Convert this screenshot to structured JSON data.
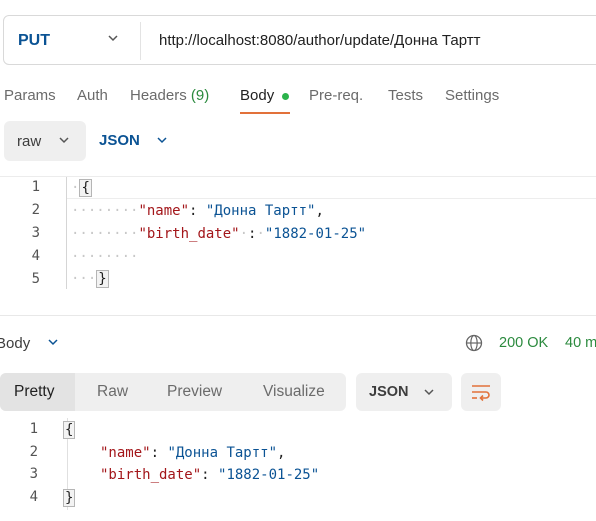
{
  "request": {
    "method": "PUT",
    "url": "http://localhost:8080/author/update/Донна Тартт"
  },
  "tabs": [
    {
      "label": "Params"
    },
    {
      "label": "Auth"
    },
    {
      "label": "Headers",
      "count": "(9)"
    },
    {
      "label": "Body"
    },
    {
      "label": "Pre-req."
    },
    {
      "label": "Tests"
    },
    {
      "label": "Settings"
    }
  ],
  "body_options": {
    "mode": "raw",
    "format": "JSON"
  },
  "request_editor": {
    "line_numbers": [
      "1",
      "2",
      "3",
      "4",
      "5"
    ],
    "open_brace": "{",
    "name_key": "\"name\"",
    "name_value": "\"Донна Тартт\"",
    "birth_key": "\"birth_date\"",
    "birth_value": "\"1882-01-25\"",
    "close_brace": "}"
  },
  "response": {
    "section_label": "Body",
    "status": "200 OK",
    "time": "40 m",
    "view_tabs": [
      "Pretty",
      "Raw",
      "Preview",
      "Visualize"
    ],
    "format": "JSON",
    "line_numbers": [
      "1",
      "2",
      "3",
      "4"
    ],
    "open_brace": "{",
    "name_key": "\"name\"",
    "name_value": "\"Донна Тартт\"",
    "birth_key": "\"birth_date\"",
    "birth_value": "\"1882-01-25\"",
    "close_brace": "}"
  },
  "colors": {
    "accent": "#e2713a",
    "status_ok": "#2b8a3e",
    "method": "#0b5394",
    "json_key": "#a3161a",
    "json_string": "#0b5394"
  }
}
